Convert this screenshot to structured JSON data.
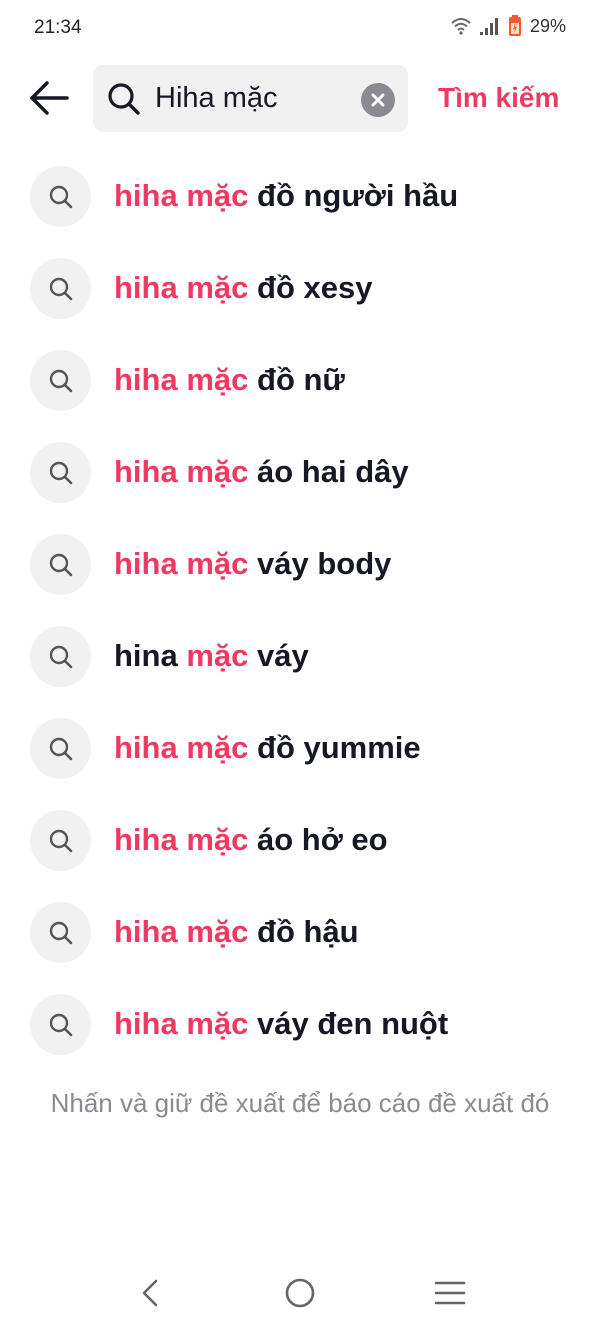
{
  "status_bar": {
    "time": "21:34",
    "battery_percent": "29%",
    "icons": [
      "wifi-icon",
      "signal-icon",
      "battery-icon"
    ]
  },
  "header": {
    "back_icon": "arrow-left-icon",
    "search": {
      "value": "Hiha mặc",
      "icon": "search-icon",
      "clear_icon": "clear-icon"
    },
    "search_action_label": "Tìm kiếm"
  },
  "suggestions": [
    {
      "highlight": "hiha mặc",
      "rest": " đồ người hầu"
    },
    {
      "highlight": "hiha mặc",
      "rest": " đồ xesy"
    },
    {
      "highlight": "hiha mặc",
      "rest": " đồ nữ"
    },
    {
      "highlight": "hiha mặc",
      "rest": " áo hai dây"
    },
    {
      "highlight": "hiha mặc",
      "rest": " váy body"
    },
    {
      "prefix": "hina ",
      "highlight": "mặc",
      "rest": " váy"
    },
    {
      "highlight": "hiha mặc",
      "rest": " đồ yummie"
    },
    {
      "highlight": "hiha mặc",
      "rest": " áo hở eo"
    },
    {
      "highlight": "hiha mặc",
      "rest": " đồ hậu"
    },
    {
      "highlight": "hiha mặc",
      "rest": " váy đen nuột"
    }
  ],
  "hint_text": "Nhấn và giữ đề xuất để báo cáo đề xuất đó",
  "navbar": {
    "icons": [
      "nav-back-icon",
      "nav-home-icon",
      "nav-menu-icon"
    ]
  },
  "colors": {
    "accent": "#ee3a63",
    "text": "#161823",
    "muted": "#8a8b91",
    "chip_bg": "#f1f1f2",
    "battery": "#f5582f"
  }
}
